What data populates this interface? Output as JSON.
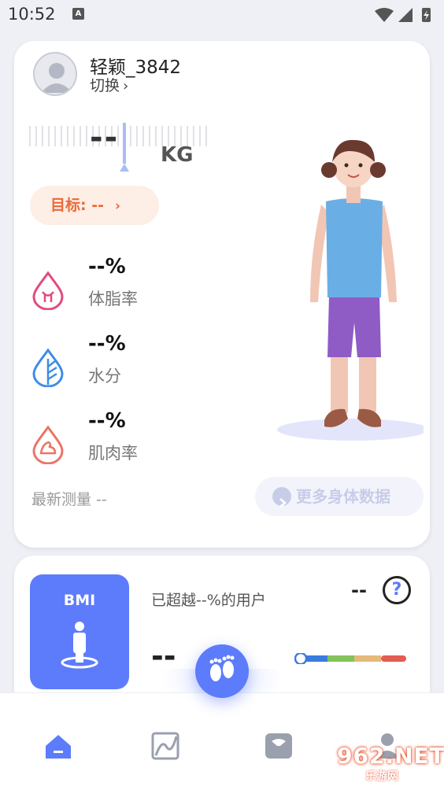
{
  "status_bar": {
    "time": "10:52",
    "notification_icon": "a-icon"
  },
  "profile": {
    "username": "轻颖_3842",
    "switch_label": "切换",
    "avatar_icon": "user-avatar-icon"
  },
  "weight": {
    "value": "--",
    "unit": "KG"
  },
  "goal": {
    "label": "目标: --"
  },
  "metrics": [
    {
      "value": "--%",
      "label": "体脂率",
      "icon": "fat-drop-icon",
      "color": "#e34b7c"
    },
    {
      "value": "--%",
      "label": "水分",
      "icon": "water-leaf-icon",
      "color": "#3d8de6"
    },
    {
      "value": "--%",
      "label": "肌肉率",
      "icon": "muscle-drop-icon",
      "color": "#ec7466"
    }
  ],
  "latest": {
    "label": "最新测量 --"
  },
  "more_button": {
    "label": "更多身体数据"
  },
  "bmi": {
    "title": "BMI",
    "exceed_text": "已超越--%的用户",
    "side_value": "--",
    "help_symbol": "?",
    "value": "--",
    "scale_colors": [
      "#3b7be0",
      "#82c35a",
      "#e5b97a",
      "#e35c52"
    ]
  },
  "tabs": [
    {
      "name": "home",
      "icon": "home-icon",
      "active": true
    },
    {
      "name": "trend",
      "icon": "chart-icon",
      "active": false
    },
    {
      "name": "scale",
      "icon": "scale-icon",
      "active": false
    },
    {
      "name": "me",
      "icon": "profile-icon",
      "active": false
    }
  ],
  "colors": {
    "accent": "#5d7cfb",
    "goal": "#ea6a36"
  },
  "watermark": {
    "text": "962.NET",
    "sub": "乐游网"
  }
}
